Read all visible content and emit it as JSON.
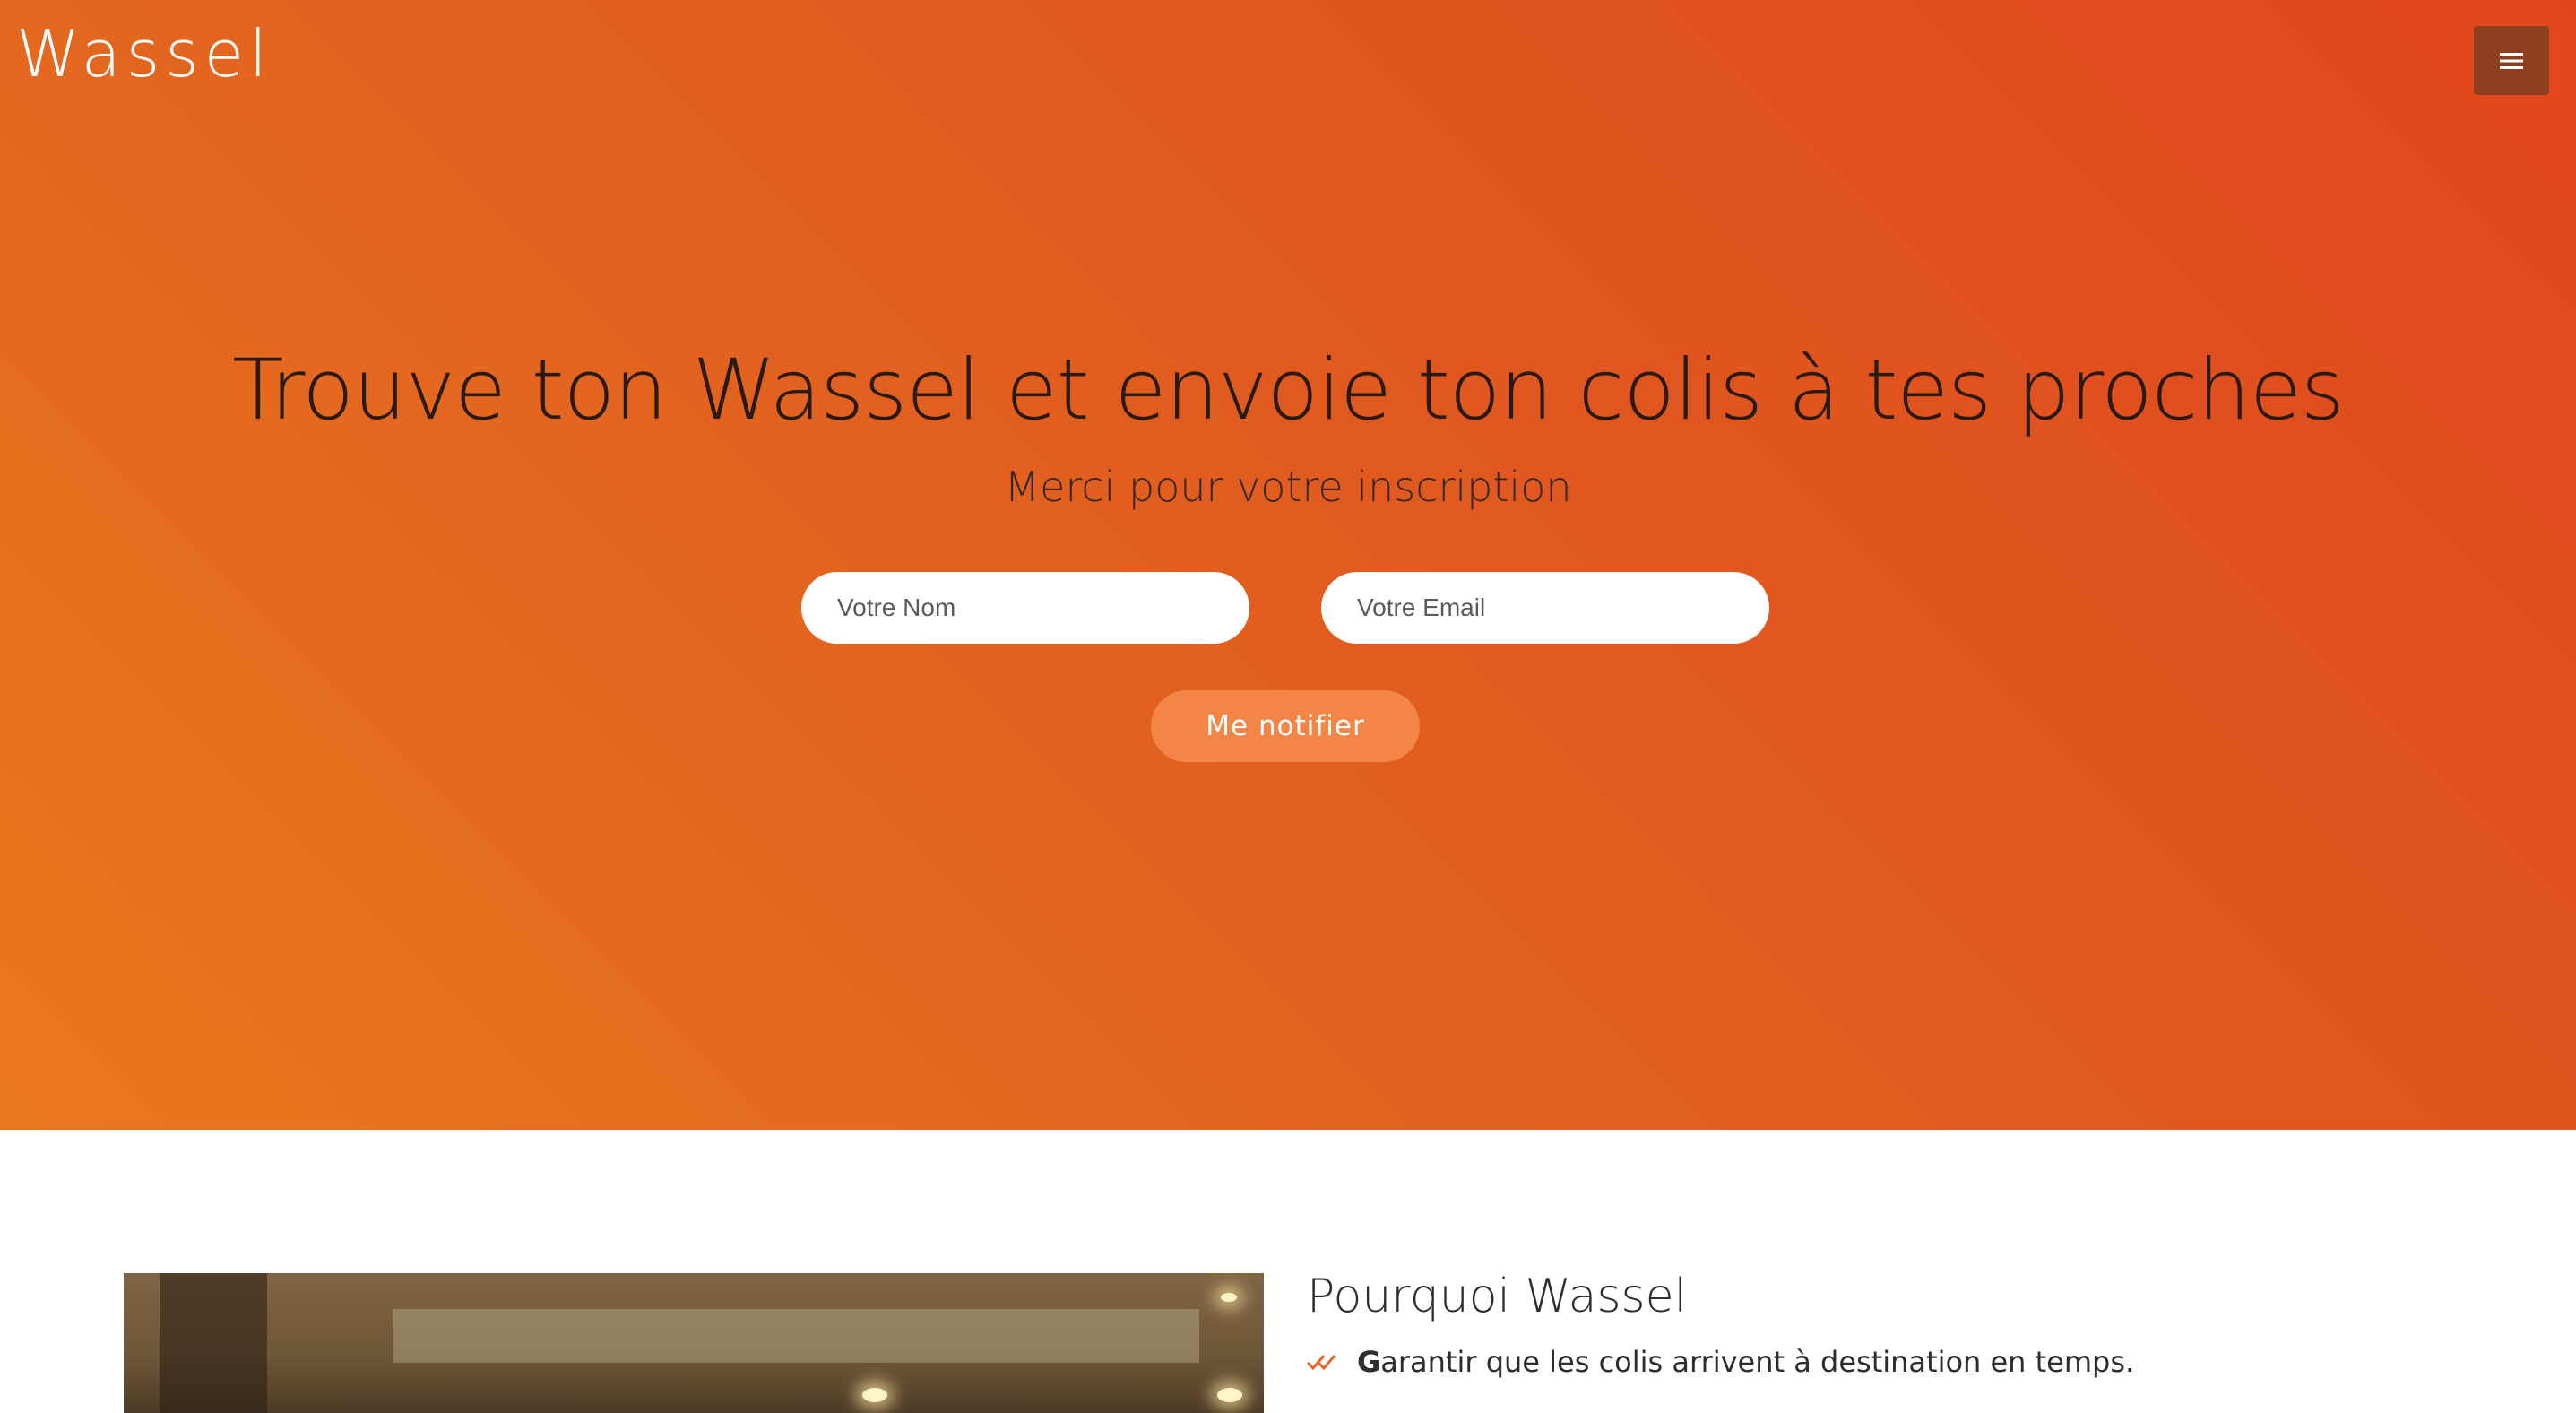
{
  "header": {
    "brand": "Wassel",
    "menu_icon": "hamburger-menu-icon"
  },
  "hero": {
    "headline": "Trouve ton Wassel et envoie ton colis à tes proches",
    "subheadline": "Merci pour votre inscription",
    "form": {
      "name_placeholder": "Votre Nom",
      "name_value": "",
      "email_placeholder": "Votre Email",
      "email_value": "",
      "submit_label": "Me notifier"
    }
  },
  "why": {
    "title": "Pourquoi Wassel",
    "items": [
      {
        "icon": "double-check-icon",
        "first_letter": "G",
        "rest": "arantir que les colis arrivent à destination en temps."
      }
    ]
  },
  "colors": {
    "hero_gradient_start": "#e8781f",
    "hero_gradient_end": "#e1471d",
    "menu_button": "#8f3e1f",
    "notify_button": "#f38547",
    "check_icon": "#e8672a"
  }
}
